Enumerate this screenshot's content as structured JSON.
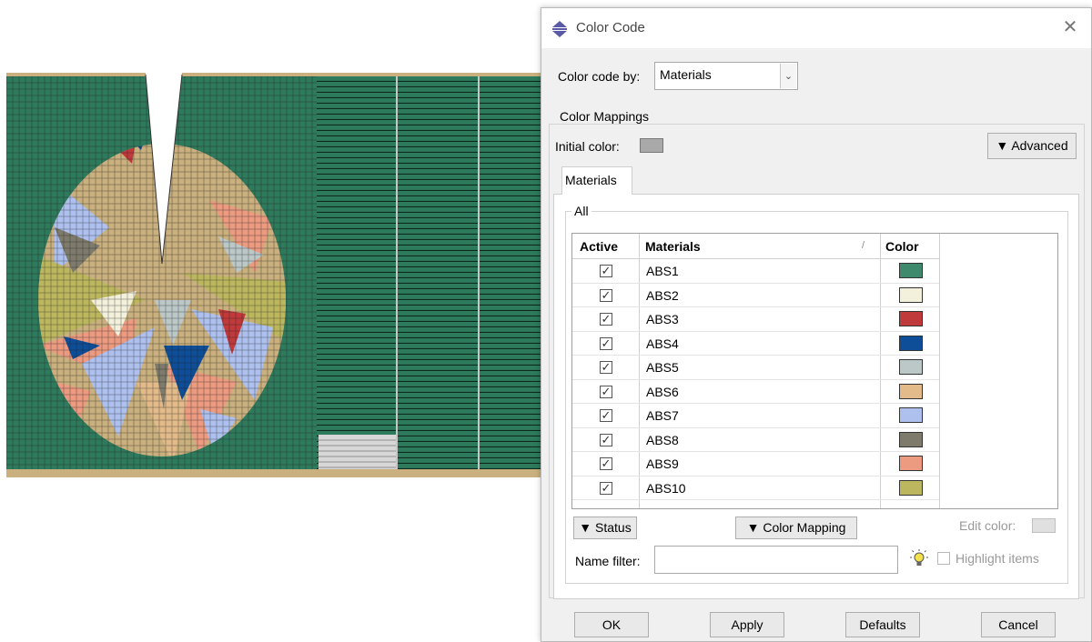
{
  "dialog": {
    "title": "Color Code",
    "close_glyph": "✕",
    "color_code_by_label": "Color code by:",
    "color_code_by_value": "Materials",
    "color_mappings_label": "Color Mappings",
    "initial_color_label": "Initial color:",
    "advanced_label": "▼ Advanced",
    "tab_label": "Materials",
    "all_label": "All",
    "table": {
      "headers": [
        "Active",
        "Materials",
        "Color"
      ],
      "sort_glyph": "/",
      "rows": [
        {
          "active": true,
          "name": "ABS1",
          "color": "#3f8a6c"
        },
        {
          "active": true,
          "name": "ABS2",
          "color": "#f3f0dc"
        },
        {
          "active": true,
          "name": "ABS3",
          "color": "#c0393b"
        },
        {
          "active": true,
          "name": "ABS4",
          "color": "#0e4e98"
        },
        {
          "active": true,
          "name": "ABS5",
          "color": "#bcc8c8"
        },
        {
          "active": true,
          "name": "ABS6",
          "color": "#e3bb8a"
        },
        {
          "active": true,
          "name": "ABS7",
          "color": "#adc0ee"
        },
        {
          "active": true,
          "name": "ABS8",
          "color": "#7e7b6c"
        },
        {
          "active": true,
          "name": "ABS9",
          "color": "#ec9a80"
        },
        {
          "active": true,
          "name": "ABS10",
          "color": "#bcb75f"
        }
      ]
    },
    "status_label": "▼ Status",
    "color_mapping_label": "▼ Color Mapping",
    "edit_color_label": "Edit color:",
    "name_filter_label": "Name filter:",
    "name_filter_value": "",
    "highlight_items_label": "Highlight items",
    "buttons": {
      "ok": "OK",
      "apply": "Apply",
      "defaults": "Defaults",
      "cancel": "Cancel"
    }
  },
  "viewport": {
    "mesh_colors": {
      "background_mesh": "#2e7a5c",
      "gap_color": "#ffffff",
      "tan": "#c9b07e",
      "olive": "#bcb75f"
    }
  }
}
